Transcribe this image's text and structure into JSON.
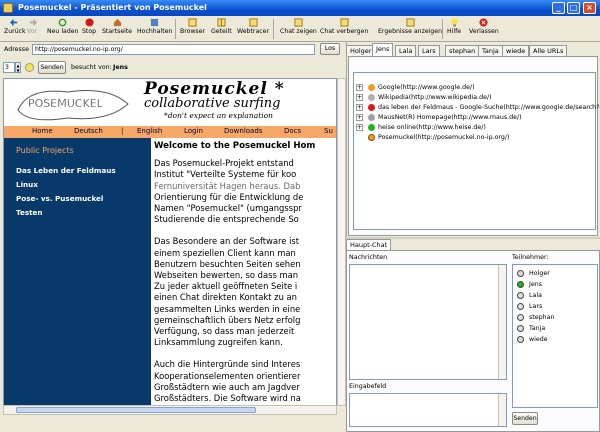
{
  "window": {
    "title": "Posemuckel - Präsentiert von Posemuckel",
    "min": "_",
    "max": "□",
    "close": "×"
  },
  "toolbar": {
    "back": "Zurück",
    "forward": "Vor",
    "reload": "Neu laden",
    "stop": "Stop",
    "home": "Startseite",
    "hold": "Hochhalten",
    "browser": "Browser",
    "split": "Geteilt",
    "webtracer": "Webtracer",
    "show_chat": "Chat zeigen",
    "hide_chat": "Chat verbergen",
    "results": "Ergebnisse anzeigen",
    "help": "Hilfe",
    "quit": "Verlassen"
  },
  "address": {
    "label": "Adresse",
    "value": "http://posemuckel.no-ip.org/",
    "go": "Los"
  },
  "visit": {
    "count": "3",
    "send": "Senden",
    "visited_by_label": "besucht von:",
    "visited_by": "Jens"
  },
  "page": {
    "logo_text": "POSEMUCKEL",
    "brand": "Posemuckel *",
    "slogan": "collaborative surfing",
    "tagline": "*don't expect an explanation",
    "nav": [
      "Home",
      "Deutsch",
      "|",
      "English",
      "Login",
      "Downloads",
      "Docs",
      "Su"
    ],
    "sidebar_title": "Public Projects",
    "sidebar": [
      "Das Leben der Feldmaus",
      "Linux",
      "Pose- vs. Pusemuckel",
      "Testen"
    ],
    "heading": "Welcome to the Posemuckel Hom",
    "para1": [
      "Das Posemuckel-Projekt entstand",
      "Institut \"Verteilte Systeme für koo",
      "Fernuniversität Hagen heraus. Dab",
      "Orientierung für die Entwicklung de",
      "Namen \"Posemuckel\" (umgangsspr",
      "Studierende die entsprechende So"
    ],
    "para2": [
      "Das Besondere an der Software ist",
      "einem speziellen Client kann man",
      "Benutzern besuchten Seiten sehen",
      "Webseiten bewerten, so dass man",
      "Zu jeder aktuell geöffneten Seite i",
      "einen Chat direkten Kontakt zu an",
      "gesammelten Links werden in eine",
      "gemeinschaftlich übers Netz erfolg",
      "Verfügung, so dass man jederzeit",
      "Linksammlung zugreifen kann."
    ],
    "para3": [
      "Auch die Hintergründe sind Interes",
      "Kooperationselementen orientierer",
      "Großstädtern wie auch am Jagdver",
      "Großstädters. Die Software wird na"
    ]
  },
  "tabs": [
    "Holger",
    "Jens",
    "Lala",
    "Lars",
    "stephan",
    "Tanja",
    "wiede",
    "Alle URLs"
  ],
  "tree": [
    {
      "label": "Google(http://www.google.de/)",
      "color": "#f0a020"
    },
    {
      "label": "Wikipedia(http://www.wikipedia.de/)",
      "color": "#b0b0b0"
    },
    {
      "label": "das leben der Feldmaus - Google-Suche(http://www.google.de/search?c",
      "color": "#d81818"
    },
    {
      "label": "MausNet(R) Homepage(http://www.maus.de/)",
      "color": "#a0a0a0"
    },
    {
      "label": "heise online(http://www.heise.de/)",
      "color": "#20b020"
    },
    {
      "label": "Posemuckel(http://posemuckel.no-ip.org/)",
      "color": "#f0a020"
    }
  ],
  "chat": {
    "tab": "Haupt-Chat",
    "messages_label": "Nachrichten",
    "input_label": "Eingabefeld",
    "participants_label": "Teilnehmer:",
    "send": "Senden"
  },
  "participants": [
    "Holger",
    "Jens",
    "Lala",
    "Lars",
    "stephan",
    "Tanja",
    "wiede"
  ]
}
